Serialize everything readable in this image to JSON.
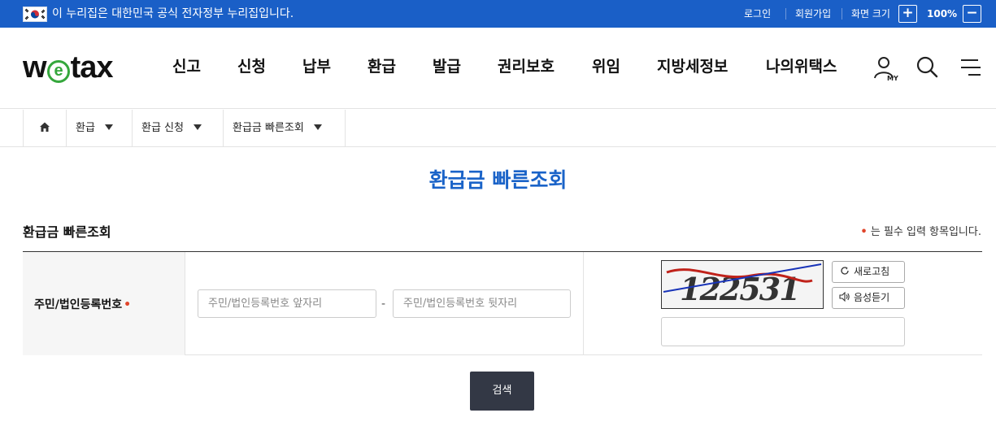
{
  "gov_banner": {
    "text": "이 누리집은 대한민국 공식 전자정부 누리집입니다.",
    "login": "로그인",
    "signup": "회원가입",
    "screen_size_label": "화면 크기",
    "zoom_in": "+",
    "zoom_level": "100%",
    "zoom_out": "−"
  },
  "logo": {
    "pre": "w",
    "mid": "e",
    "post": "tax"
  },
  "gnb": [
    "신고",
    "신청",
    "납부",
    "환급",
    "발급",
    "권리보호",
    "위임",
    "지방세정보",
    "나의위택스"
  ],
  "header_icons": {
    "my": "MY"
  },
  "breadcrumb": [
    "환급",
    "환급 신청",
    "환급금 빠른조회"
  ],
  "page_title": "환급금 빠른조회",
  "section": {
    "title": "환급금 빠른조회",
    "required_note": "는 필수 입력 항목입니다.",
    "required_mark": "•"
  },
  "form": {
    "label": "주민/법인등록번호",
    "front_placeholder": "주민/법인등록번호 앞자리",
    "separator": "-",
    "back_placeholder": "주민/법인등록번호 뒷자리",
    "captcha_text": "122531",
    "refresh_label": "새로고침",
    "audio_label": "음성듣기",
    "captcha_value": ""
  },
  "search_button": "검색",
  "colors": {
    "banner": "#1a5fc7",
    "title_blue": "#1a63c8",
    "logo_green": "#35a73c",
    "required_red": "#e0452b",
    "search_btn": "#333845"
  }
}
